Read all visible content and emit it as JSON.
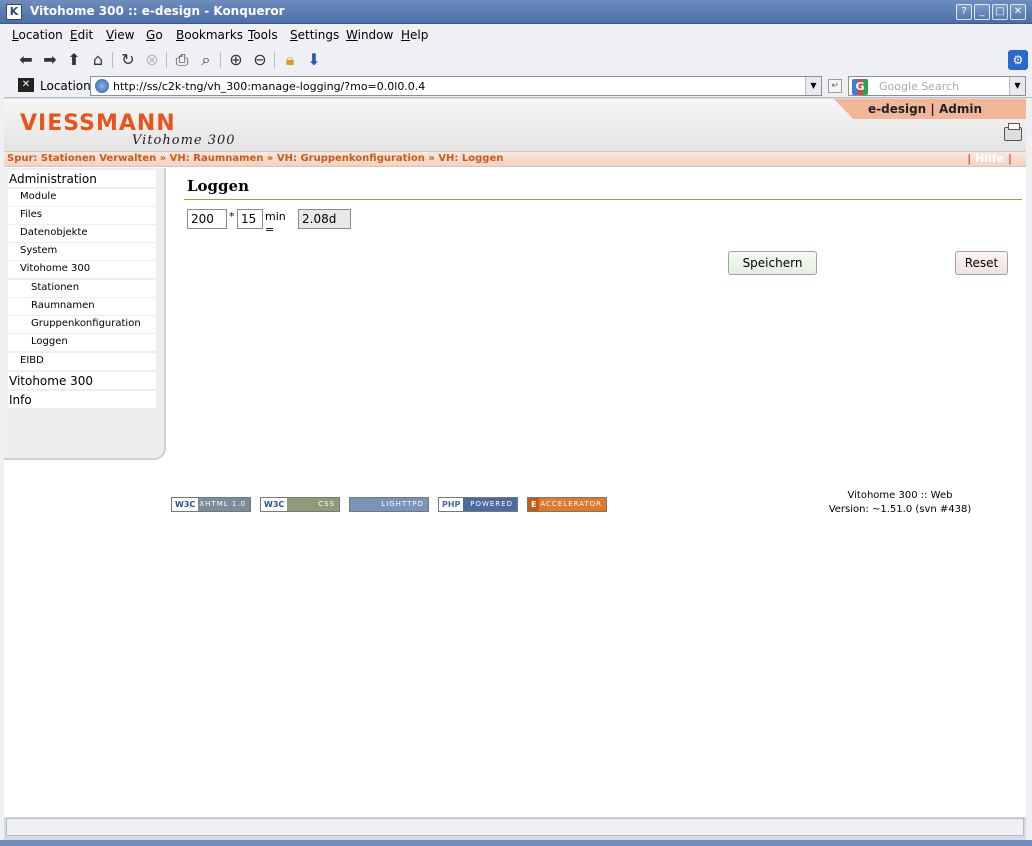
{
  "window": {
    "title": "Vitohome 300 :: e-design - Konqueror",
    "buttons": [
      "?",
      "_",
      "□",
      "✕"
    ]
  },
  "menubar": {
    "items": [
      {
        "label": "Location",
        "u": "L",
        "rest": "ocation"
      },
      {
        "label": "Edit",
        "u": "E",
        "rest": "dit"
      },
      {
        "label": "View",
        "u": "V",
        "rest": "iew"
      },
      {
        "label": "Go",
        "u": "G",
        "rest": "o"
      },
      {
        "label": "Bookmarks",
        "u": "B",
        "rest": "ookmarks"
      },
      {
        "label": "Tools",
        "u": "T",
        "rest": "ools"
      },
      {
        "label": "Settings",
        "u": "S",
        "rest": "ettings"
      },
      {
        "label": "Window",
        "u": "W",
        "rest": "indow"
      },
      {
        "label": "Help",
        "u": "H",
        "rest": "elp"
      }
    ]
  },
  "locationbar": {
    "label": "Location:",
    "url": "http://ss/c2k-tng/vh_300:manage-logging/?mo=0.0l0.0.4",
    "search_placeholder": "Google Search"
  },
  "header": {
    "logo": "VIESSMANN",
    "logo_sub": "Vitohome 300",
    "user": "e-design | Admin"
  },
  "breadcrumb": {
    "prefix": "Spur:",
    "items": [
      "Stationen Verwalten",
      "VH: Raumnamen",
      "VH: Gruppenkonfiguration",
      "VH: Loggen"
    ],
    "separator": "»",
    "help": "Hilfe"
  },
  "sidebar": {
    "items": [
      {
        "label": "Administration",
        "level": 1
      },
      {
        "label": "Module",
        "level": 2
      },
      {
        "label": "Files",
        "level": 2
      },
      {
        "label": "Datenobjekte",
        "level": 2
      },
      {
        "label": "System",
        "level": 2
      },
      {
        "label": "Vitohome 300",
        "level": 2
      },
      {
        "label": "Stationen",
        "level": 3
      },
      {
        "label": "Raumnamen",
        "level": 3
      },
      {
        "label": "Gruppenkonfiguration",
        "level": 3
      },
      {
        "label": "Loggen",
        "level": 3
      },
      {
        "label": "EIBD",
        "level": 2
      },
      {
        "label": "Vitohome 300",
        "level": 1
      },
      {
        "label": "Info",
        "level": 1
      }
    ]
  },
  "main": {
    "title": "Loggen",
    "count_value": "200",
    "times_symbol": "*",
    "interval_value": "15",
    "unit_label": "min =",
    "result_value": "2.08d",
    "save_label": "Speichern",
    "reset_label": "Reset"
  },
  "footer": {
    "badges": [
      {
        "left": "W3C",
        "right": "XHTML 1.0"
      },
      {
        "left": "W3C",
        "right": "CSS"
      },
      {
        "left": "",
        "right": "LIGHTTPD"
      },
      {
        "left": "PHP",
        "right": "POWERED"
      },
      {
        "left": "E",
        "right": "ACCELERATOR"
      }
    ],
    "version_line1": "Vitohome 300 :: Web",
    "version_line2": "Version: ~1.51.0 (svn #438)"
  }
}
